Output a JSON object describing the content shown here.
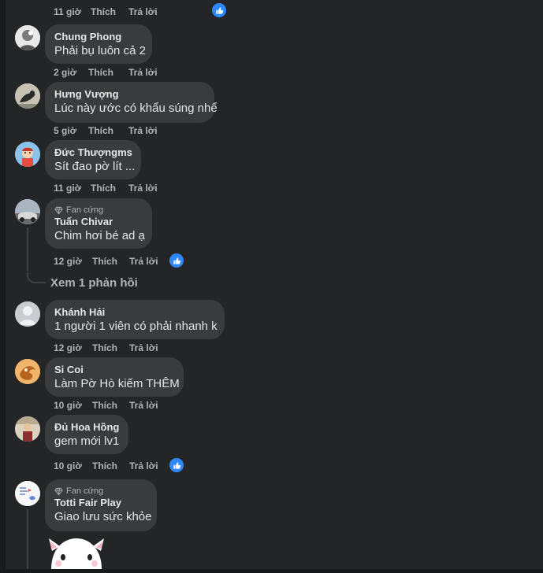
{
  "colors": {
    "background": "#242526",
    "bubble": "#3a3b3c",
    "accent": "#2e89ff",
    "text": "#e4e6eb",
    "meta": "#b0b3b8"
  },
  "actions": {
    "like": "Thích",
    "reply": "Trả lời"
  },
  "fan_badge": "Fan cứng",
  "top_row": {
    "time": "11 giờ",
    "liked": true
  },
  "comments": [
    {
      "name": "Chung Phong",
      "text": "Phải bụ luôn cả 2",
      "time": "2 giờ",
      "liked": false,
      "fan": false
    },
    {
      "name": "Hưng Vượng",
      "text": "Lúc này ước có khẩu súng nhể",
      "time": "5 giờ",
      "liked": false,
      "fan": false
    },
    {
      "name": "Đức Thượngms",
      "text": "Sít đao pờ lít ...",
      "time": "11 giờ",
      "liked": false,
      "fan": false
    },
    {
      "name": "Tuấn Chivar",
      "text": "Chim hơi bé ad ạ",
      "time": "12 giờ",
      "liked": true,
      "fan": true,
      "see_replies": "Xem 1 phản hồi"
    },
    {
      "name": "Khánh Hải",
      "text": "1 người 1 viên có phải nhanh k",
      "time": "12 giờ",
      "liked": false,
      "fan": false
    },
    {
      "name": "Si Coi",
      "text": "Làm Pờ Hò kiếm THÊM",
      "time": "10 giờ",
      "liked": false,
      "fan": false
    },
    {
      "name": "Đủ Hoa Hồng",
      "text": "gem mới lv1",
      "time": "10 giờ",
      "liked": true,
      "fan": false
    },
    {
      "name": "Totti Fair Play",
      "text": "Giao lưu sức khỏe",
      "time": "",
      "liked": false,
      "fan": true,
      "sticker": "cat-sticker"
    }
  ]
}
